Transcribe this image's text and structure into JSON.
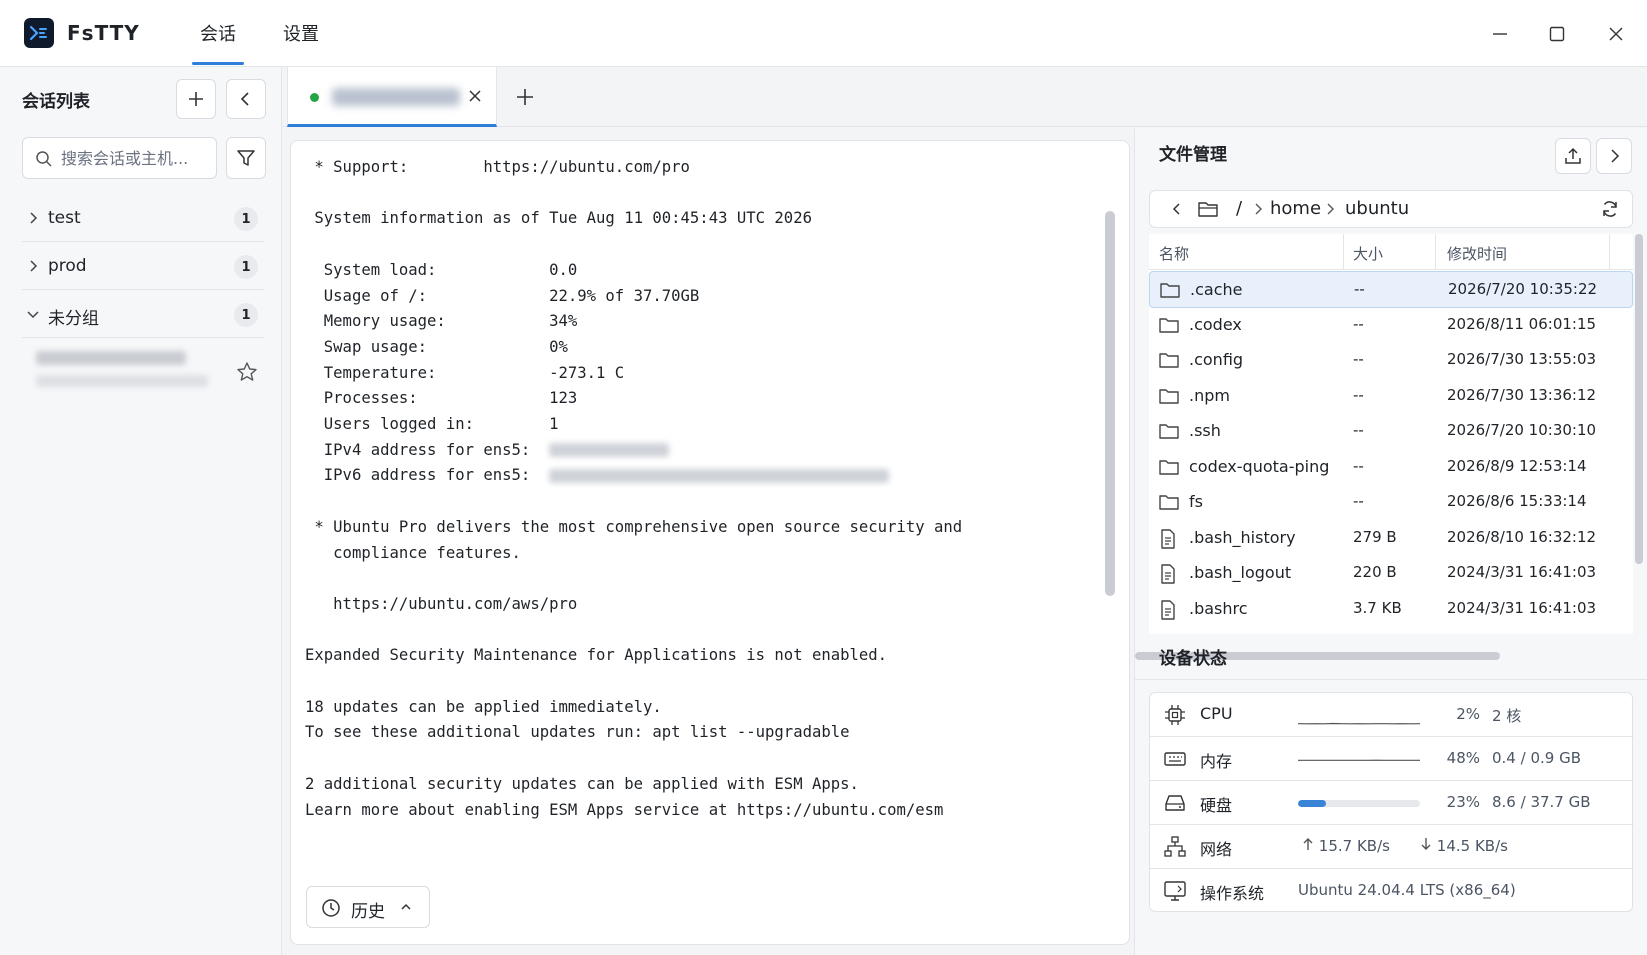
{
  "app": {
    "name": "FsTTY",
    "nav_tabs": [
      "会话",
      "设置"
    ],
    "accent": "#2f7fd8"
  },
  "sidebar": {
    "title": "会话列表",
    "search_placeholder": "搜索会话或主机...",
    "groups": [
      {
        "name": "test",
        "count": "1",
        "expanded": false
      },
      {
        "name": "prod",
        "count": "1",
        "expanded": false
      },
      {
        "name": "未分组",
        "count": "1",
        "expanded": true
      }
    ]
  },
  "terminal": {
    "status_color": "#22a447",
    "lines": [
      {
        "t": " * Support:        https://ubuntu.com/pro"
      },
      {
        "t": ""
      },
      {
        "t": " System information as of Tue Aug 11 00:45:43 UTC 2026"
      },
      {
        "t": ""
      },
      {
        "t": "  System load:            0.0"
      },
      {
        "t": "  Usage of /:             22.9% of 37.70GB"
      },
      {
        "t": "  Memory usage:           34%"
      },
      {
        "t": "  Swap usage:             0%"
      },
      {
        "t": "  Temperature:            -273.1 C"
      },
      {
        "t": "  Processes:              123"
      },
      {
        "t": "  Users logged in:        1"
      },
      {
        "t": "  IPv4 address for ens5:  ",
        "redact": 120
      },
      {
        "t": "  IPv6 address for ens5:  ",
        "redact": 340
      },
      {
        "t": ""
      },
      {
        "t": " * Ubuntu Pro delivers the most comprehensive open source security and"
      },
      {
        "t": "   compliance features."
      },
      {
        "t": ""
      },
      {
        "t": "   https://ubuntu.com/aws/pro"
      },
      {
        "t": ""
      },
      {
        "t": "Expanded Security Maintenance for Applications is not enabled."
      },
      {
        "t": ""
      },
      {
        "t": "18 updates can be applied immediately."
      },
      {
        "t": "To see these additional updates run: apt list --upgradable"
      },
      {
        "t": ""
      },
      {
        "t": "2 additional security updates can be applied with ESM Apps."
      },
      {
        "t": "Learn more about enabling ESM Apps service at https://ubuntu.com/esm"
      }
    ],
    "history_label": "历史"
  },
  "file_manager": {
    "title": "文件管理",
    "path_root": "/",
    "path": [
      "home",
      "ubuntu"
    ],
    "columns": [
      "名称",
      "大小",
      "修改时间"
    ],
    "files": [
      {
        "name": ".cache",
        "size": "--",
        "date": "2026/7/20 10:35:22",
        "type": "folder",
        "selected": true
      },
      {
        "name": ".codex",
        "size": "--",
        "date": "2026/8/11 06:01:15",
        "type": "folder"
      },
      {
        "name": ".config",
        "size": "--",
        "date": "2026/7/30 13:55:03",
        "type": "folder"
      },
      {
        "name": ".npm",
        "size": "--",
        "date": "2026/7/30 13:36:12",
        "type": "folder"
      },
      {
        "name": ".ssh",
        "size": "--",
        "date": "2026/7/20 10:30:10",
        "type": "folder"
      },
      {
        "name": "codex-quota-ping",
        "size": "--",
        "date": "2026/8/9 12:53:14",
        "type": "folder"
      },
      {
        "name": "fs",
        "size": "--",
        "date": "2026/8/6 15:33:14",
        "type": "folder"
      },
      {
        "name": ".bash_history",
        "size": "279 B",
        "date": "2026/8/10 16:32:12",
        "type": "file"
      },
      {
        "name": ".bash_logout",
        "size": "220 B",
        "date": "2024/3/31 16:41:03",
        "type": "file"
      },
      {
        "name": ".bashrc",
        "size": "3.7 KB",
        "date": "2024/3/31 16:41:03",
        "type": "file"
      }
    ]
  },
  "device_status": {
    "title": "设备状态",
    "cpu": {
      "label": "CPU",
      "percent": "2%",
      "detail": "2 核",
      "spark": [
        2,
        1,
        2,
        1,
        3,
        2,
        1,
        2,
        1,
        2,
        2,
        1,
        2,
        1,
        2
      ]
    },
    "memory": {
      "label": "内存",
      "percent": "48%",
      "detail": "0.4 / 0.9 GB",
      "spark": [
        48,
        48,
        48,
        48,
        48,
        48,
        48,
        48,
        48,
        49,
        48,
        48,
        48,
        48,
        48
      ]
    },
    "disk": {
      "label": "硬盘",
      "percent": "23%",
      "detail": "8.6 / 37.7 GB",
      "fill": 0.23
    },
    "network": {
      "label": "网络",
      "up": "15.7 KB/s",
      "down": "14.5 KB/s"
    },
    "os": {
      "label": "操作系统",
      "value": "Ubuntu 24.04.4 LTS (x86_64)"
    }
  }
}
